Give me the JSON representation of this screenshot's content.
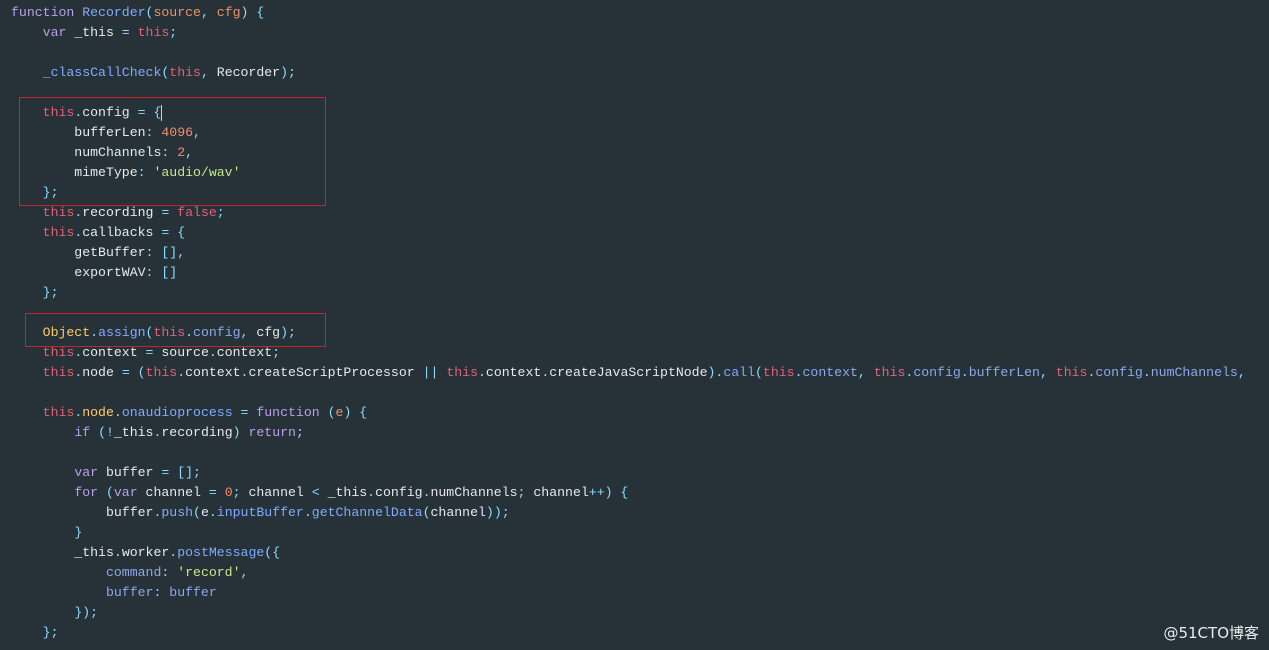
{
  "theme": {
    "background": "#263238",
    "highlight_box_color": "#c0262d"
  },
  "code_lines": [
    [
      [
        "k",
        "function "
      ],
      [
        "f",
        "Recorder"
      ],
      [
        "o",
        "("
      ],
      [
        "p",
        "source"
      ],
      [
        "o",
        ", "
      ],
      [
        "p",
        "cfg"
      ],
      [
        "o",
        ") {"
      ]
    ],
    [
      [
        "d",
        "    "
      ],
      [
        "k",
        "var "
      ],
      [
        "d",
        "_this "
      ],
      [
        "o",
        "= "
      ],
      [
        "t",
        "this"
      ],
      [
        "o",
        ";"
      ]
    ],
    [],
    [
      [
        "d",
        "    "
      ],
      [
        "f",
        "_classCallCheck"
      ],
      [
        "o",
        "("
      ],
      [
        "t",
        "this"
      ],
      [
        "o",
        ", "
      ],
      [
        "d",
        "Recorder"
      ],
      [
        "o",
        ");"
      ]
    ],
    [],
    [
      [
        "d",
        "    "
      ],
      [
        "t",
        "this"
      ],
      [
        "o",
        "."
      ],
      [
        "d",
        "config "
      ],
      [
        "o",
        "= {"
      ],
      [
        "cursor",
        ""
      ]
    ],
    [
      [
        "d",
        "        bufferLen"
      ],
      [
        "o",
        ": "
      ],
      [
        "n",
        "4096"
      ],
      [
        "o",
        ","
      ]
    ],
    [
      [
        "d",
        "        numChannels"
      ],
      [
        "o",
        ": "
      ],
      [
        "n",
        "2"
      ],
      [
        "o",
        ","
      ]
    ],
    [
      [
        "d",
        "        mimeType"
      ],
      [
        "o",
        ": "
      ],
      [
        "s",
        "'audio/wav'"
      ]
    ],
    [
      [
        "d",
        "    "
      ],
      [
        "o",
        "};"
      ]
    ],
    [
      [
        "d",
        "    "
      ],
      [
        "t",
        "this"
      ],
      [
        "o",
        "."
      ],
      [
        "d",
        "recording "
      ],
      [
        "o",
        "= "
      ],
      [
        "t",
        "false"
      ],
      [
        "o",
        ";"
      ]
    ],
    [
      [
        "d",
        "    "
      ],
      [
        "t",
        "this"
      ],
      [
        "o",
        "."
      ],
      [
        "d",
        "callbacks "
      ],
      [
        "o",
        "= {"
      ]
    ],
    [
      [
        "d",
        "        getBuffer"
      ],
      [
        "o",
        ": [],"
      ]
    ],
    [
      [
        "d",
        "        exportWAV"
      ],
      [
        "o",
        ": []"
      ]
    ],
    [
      [
        "d",
        "    "
      ],
      [
        "o",
        "};"
      ]
    ],
    [],
    [
      [
        "d",
        "    "
      ],
      [
        "c",
        "Object"
      ],
      [
        "o",
        "."
      ],
      [
        "f",
        "assign"
      ],
      [
        "o",
        "("
      ],
      [
        "t",
        "this"
      ],
      [
        "o",
        "."
      ],
      [
        "m",
        "config"
      ],
      [
        "o",
        ", "
      ],
      [
        "d",
        "cfg"
      ],
      [
        "o",
        ");"
      ]
    ],
    [
      [
        "d",
        "    "
      ],
      [
        "t",
        "this"
      ],
      [
        "o",
        "."
      ],
      [
        "d",
        "context "
      ],
      [
        "o",
        "= "
      ],
      [
        "d",
        "source"
      ],
      [
        "o",
        "."
      ],
      [
        "d",
        "context"
      ],
      [
        "o",
        ";"
      ]
    ],
    [
      [
        "d",
        "    "
      ],
      [
        "t",
        "this"
      ],
      [
        "o",
        "."
      ],
      [
        "d",
        "node "
      ],
      [
        "o",
        "= ("
      ],
      [
        "t",
        "this"
      ],
      [
        "o",
        "."
      ],
      [
        "d",
        "context"
      ],
      [
        "o",
        "."
      ],
      [
        "d",
        "createScriptProcessor "
      ],
      [
        "o",
        "|| "
      ],
      [
        "t",
        "this"
      ],
      [
        "o",
        "."
      ],
      [
        "d",
        "context"
      ],
      [
        "o",
        "."
      ],
      [
        "d",
        "createJavaScriptNode"
      ],
      [
        "o",
        ")."
      ],
      [
        "f",
        "call"
      ],
      [
        "o",
        "("
      ],
      [
        "t",
        "this"
      ],
      [
        "o",
        "."
      ],
      [
        "m",
        "context"
      ],
      [
        "o",
        ", "
      ],
      [
        "t",
        "this"
      ],
      [
        "o",
        "."
      ],
      [
        "m",
        "config"
      ],
      [
        "o",
        "."
      ],
      [
        "m",
        "bufferLen"
      ],
      [
        "o",
        ", "
      ],
      [
        "t",
        "this"
      ],
      [
        "o",
        "."
      ],
      [
        "m",
        "config"
      ],
      [
        "o",
        "."
      ],
      [
        "m",
        "numChannels"
      ],
      [
        "o",
        ", "
      ]
    ],
    [],
    [
      [
        "d",
        "    "
      ],
      [
        "t",
        "this"
      ],
      [
        "o",
        "."
      ],
      [
        "c",
        "node"
      ],
      [
        "o",
        "."
      ],
      [
        "f",
        "onaudioprocess "
      ],
      [
        "o",
        "= "
      ],
      [
        "k",
        "function "
      ],
      [
        "o",
        "("
      ],
      [
        "p",
        "e"
      ],
      [
        "o",
        ") {"
      ]
    ],
    [
      [
        "d",
        "        "
      ],
      [
        "k",
        "if "
      ],
      [
        "o",
        "(!"
      ],
      [
        "d",
        "_this"
      ],
      [
        "o",
        "."
      ],
      [
        "d",
        "recording"
      ],
      [
        "o",
        ") "
      ],
      [
        "k",
        "return"
      ],
      [
        "o",
        ";"
      ]
    ],
    [],
    [
      [
        "d",
        "        "
      ],
      [
        "k",
        "var "
      ],
      [
        "d",
        "buffer "
      ],
      [
        "o",
        "= [];"
      ]
    ],
    [
      [
        "d",
        "        "
      ],
      [
        "k",
        "for "
      ],
      [
        "o",
        "("
      ],
      [
        "k",
        "var "
      ],
      [
        "d",
        "channel "
      ],
      [
        "o",
        "= "
      ],
      [
        "n",
        "0"
      ],
      [
        "o",
        "; "
      ],
      [
        "d",
        "channel "
      ],
      [
        "o",
        "< "
      ],
      [
        "d",
        "_this"
      ],
      [
        "o",
        "."
      ],
      [
        "d",
        "config"
      ],
      [
        "o",
        "."
      ],
      [
        "d",
        "numChannels"
      ],
      [
        "o",
        "; "
      ],
      [
        "d",
        "channel"
      ],
      [
        "o",
        "++) {"
      ]
    ],
    [
      [
        "d",
        "            buffer"
      ],
      [
        "o",
        "."
      ],
      [
        "f",
        "push"
      ],
      [
        "o",
        "("
      ],
      [
        "d",
        "e"
      ],
      [
        "o",
        "."
      ],
      [
        "f",
        "inputBuffer"
      ],
      [
        "o",
        "."
      ],
      [
        "f",
        "getChannelData"
      ],
      [
        "o",
        "("
      ],
      [
        "d",
        "channel"
      ],
      [
        "o",
        "));"
      ]
    ],
    [
      [
        "d",
        "        "
      ],
      [
        "o",
        "}"
      ]
    ],
    [
      [
        "d",
        "        _this"
      ],
      [
        "o",
        "."
      ],
      [
        "d",
        "worker"
      ],
      [
        "o",
        "."
      ],
      [
        "f",
        "postMessage"
      ],
      [
        "o",
        "({"
      ]
    ],
    [
      [
        "d",
        "            "
      ],
      [
        "m",
        "command"
      ],
      [
        "o",
        ": "
      ],
      [
        "s",
        "'record'"
      ],
      [
        "o",
        ","
      ]
    ],
    [
      [
        "d",
        "            "
      ],
      [
        "m",
        "buffer"
      ],
      [
        "o",
        ": "
      ],
      [
        "m",
        "buffer"
      ]
    ],
    [
      [
        "d",
        "        "
      ],
      [
        "o",
        "});"
      ]
    ],
    [
      [
        "d",
        "    "
      ],
      [
        "o",
        "};"
      ]
    ]
  ],
  "watermark": "@51CTO博客"
}
